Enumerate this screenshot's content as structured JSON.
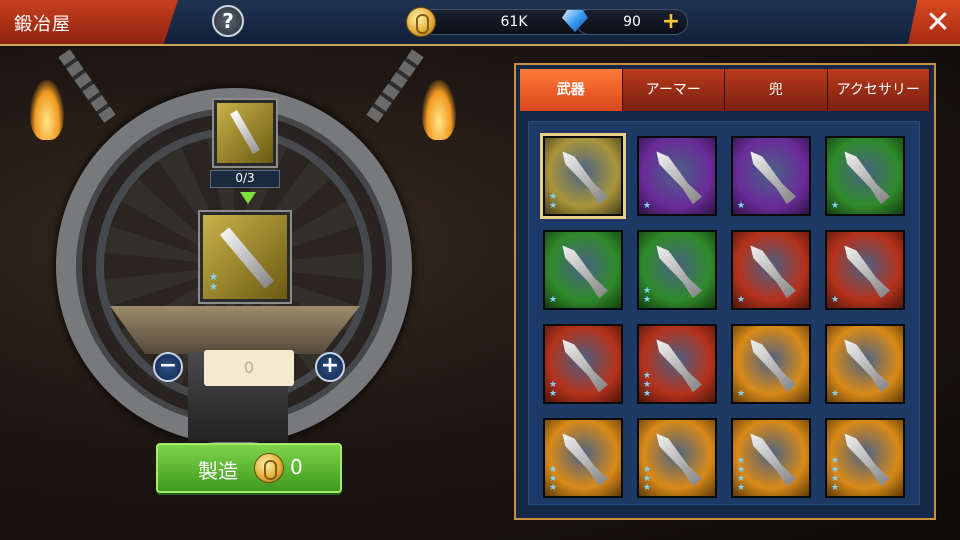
{
  "header": {
    "title": "鍛冶屋",
    "help_label": "?",
    "gold": "61K",
    "gems": "90",
    "plus": "+",
    "close_label": "✕"
  },
  "forge": {
    "material_count": "0/3",
    "quantity": "0",
    "minus": "−",
    "plus": "+",
    "craft_label": "製造",
    "craft_cost": "0"
  },
  "tabs": [
    {
      "label": "武器",
      "active": true
    },
    {
      "label": "アーマー",
      "active": false
    },
    {
      "label": "兜",
      "active": false
    },
    {
      "label": "アクセサリー",
      "active": false
    }
  ],
  "items": [
    {
      "name": "item-1",
      "bg": "#a8953a",
      "stars": 2,
      "selected": true
    },
    {
      "name": "item-2",
      "bg": "#6a2c9a",
      "stars": 1
    },
    {
      "name": "item-3",
      "bg": "#6a2c9a",
      "stars": 1
    },
    {
      "name": "item-4",
      "bg": "#2f8a2a",
      "stars": 1
    },
    {
      "name": "item-5",
      "bg": "#2f8a2a",
      "stars": 1
    },
    {
      "name": "item-6",
      "bg": "#2f8a2a",
      "stars": 2
    },
    {
      "name": "item-7",
      "bg": "#b5321c",
      "stars": 1
    },
    {
      "name": "item-8",
      "bg": "#b5321c",
      "stars": 1
    },
    {
      "name": "item-9",
      "bg": "#b5321c",
      "stars": 2
    },
    {
      "name": "item-10",
      "bg": "#b5321c",
      "stars": 3
    },
    {
      "name": "item-11",
      "bg": "#d98a18",
      "stars": 1
    },
    {
      "name": "item-12",
      "bg": "#d98a18",
      "stars": 1
    },
    {
      "name": "item-13",
      "bg": "#d98a18",
      "stars": 3
    },
    {
      "name": "item-14",
      "bg": "#d98a18",
      "stars": 3
    },
    {
      "name": "item-15",
      "bg": "#d98a18",
      "stars": 4
    },
    {
      "name": "item-16",
      "bg": "#d98a18",
      "stars": 4
    }
  ]
}
